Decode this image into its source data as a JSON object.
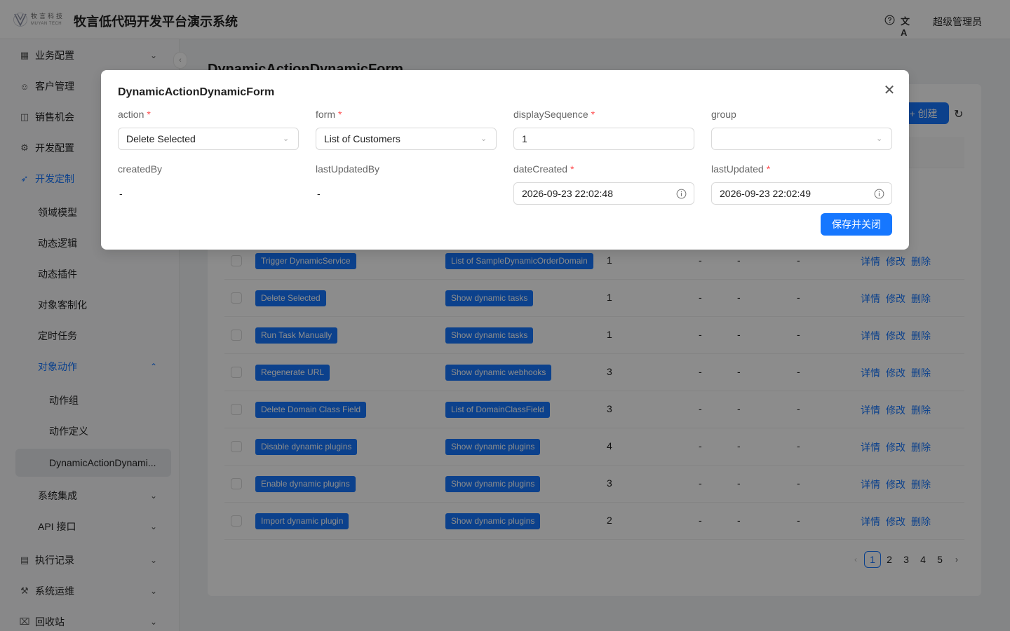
{
  "header": {
    "logo_cn": "牧言科技",
    "logo_en": "MUYAN TECH",
    "app_title": "牧言低代码开发平台演示系统",
    "lang_glyph": "文A",
    "user_name": "超级管理员"
  },
  "sidebar": {
    "items": [
      {
        "label": "业务配置",
        "icon": "building-icon"
      },
      {
        "label": "客户管理",
        "icon": "users-icon"
      },
      {
        "label": "销售机会",
        "icon": "chart-icon"
      },
      {
        "label": "开发配置",
        "icon": "gear-icon"
      },
      {
        "label": "开发定制",
        "icon": "rocket-icon"
      }
    ],
    "sub_items": [
      "领域模型",
      "动态逻辑",
      "动态插件",
      "对象客制化",
      "定时任务",
      "对象动作"
    ],
    "sub2_items": [
      "动作组",
      "动作定义",
      "DynamicActionDynami..."
    ],
    "lower_sub_items": [
      "系统集成",
      "API 接口"
    ],
    "bottom_items": [
      {
        "label": "执行记录",
        "icon": "clipboard-icon"
      },
      {
        "label": "系统运维",
        "icon": "wrench-icon"
      },
      {
        "label": "回收站",
        "icon": "trash-icon"
      }
    ]
  },
  "main": {
    "page_title": "DynamicActionDynamicForm",
    "create_label": "创建",
    "rows": [
      {
        "action": "Trigger DynamicService",
        "form": "List of SampleDynamicOrderDomain",
        "seq": "1",
        "group": "-",
        "createdBy": "-",
        "lastUpdatedBy": "-"
      },
      {
        "action": "Delete Selected",
        "form": "Show dynamic tasks",
        "seq": "1",
        "group": "-",
        "createdBy": "-",
        "lastUpdatedBy": "-"
      },
      {
        "action": "Run Task Manually",
        "form": "Show dynamic tasks",
        "seq": "1",
        "group": "-",
        "createdBy": "-",
        "lastUpdatedBy": "-"
      },
      {
        "action": "Regenerate URL",
        "form": "Show dynamic webhooks",
        "seq": "3",
        "group": "-",
        "createdBy": "-",
        "lastUpdatedBy": "-"
      },
      {
        "action": "Delete Domain Class Field",
        "form": "List of DomainClassField",
        "seq": "3",
        "group": "-",
        "createdBy": "-",
        "lastUpdatedBy": "-"
      },
      {
        "action": "Disable dynamic plugins",
        "form": "Show dynamic plugins",
        "seq": "4",
        "group": "-",
        "createdBy": "-",
        "lastUpdatedBy": "-"
      },
      {
        "action": "Enable dynamic plugins",
        "form": "Show dynamic plugins",
        "seq": "3",
        "group": "-",
        "createdBy": "-",
        "lastUpdatedBy": "-"
      },
      {
        "action": "Import dynamic plugin",
        "form": "Show dynamic plugins",
        "seq": "2",
        "group": "-",
        "createdBy": "-",
        "lastUpdatedBy": "-"
      }
    ],
    "ops": {
      "detail": "详情",
      "edit": "修改",
      "delete": "删除"
    },
    "pagination": {
      "pages": [
        "1",
        "2",
        "3",
        "4",
        "5"
      ],
      "current": "1"
    }
  },
  "modal": {
    "title": "DynamicActionDynamicForm",
    "fields": {
      "action": {
        "label": "action",
        "value": "Delete Selected",
        "required": true
      },
      "form": {
        "label": "form",
        "value": "List of Customers",
        "required": true
      },
      "displaySequence": {
        "label": "displaySequence",
        "value": "1",
        "required": true
      },
      "group": {
        "label": "group",
        "value": "",
        "required": false
      },
      "createdBy": {
        "label": "createdBy",
        "value": "-"
      },
      "lastUpdatedBy": {
        "label": "lastUpdatedBy",
        "value": "-"
      },
      "dateCreated": {
        "label": "dateCreated",
        "value": "2026-09-23 22:02:48",
        "required": true
      },
      "lastUpdated": {
        "label": "lastUpdated",
        "value": "2026-09-23 22:02:49",
        "required": true
      }
    },
    "required_mark": "*",
    "save_label": "保存并关闭"
  },
  "colors": {
    "accent": "#1677ff",
    "required": "#ff4d4f",
    "mask": "rgba(0,0,0,0.45)"
  }
}
